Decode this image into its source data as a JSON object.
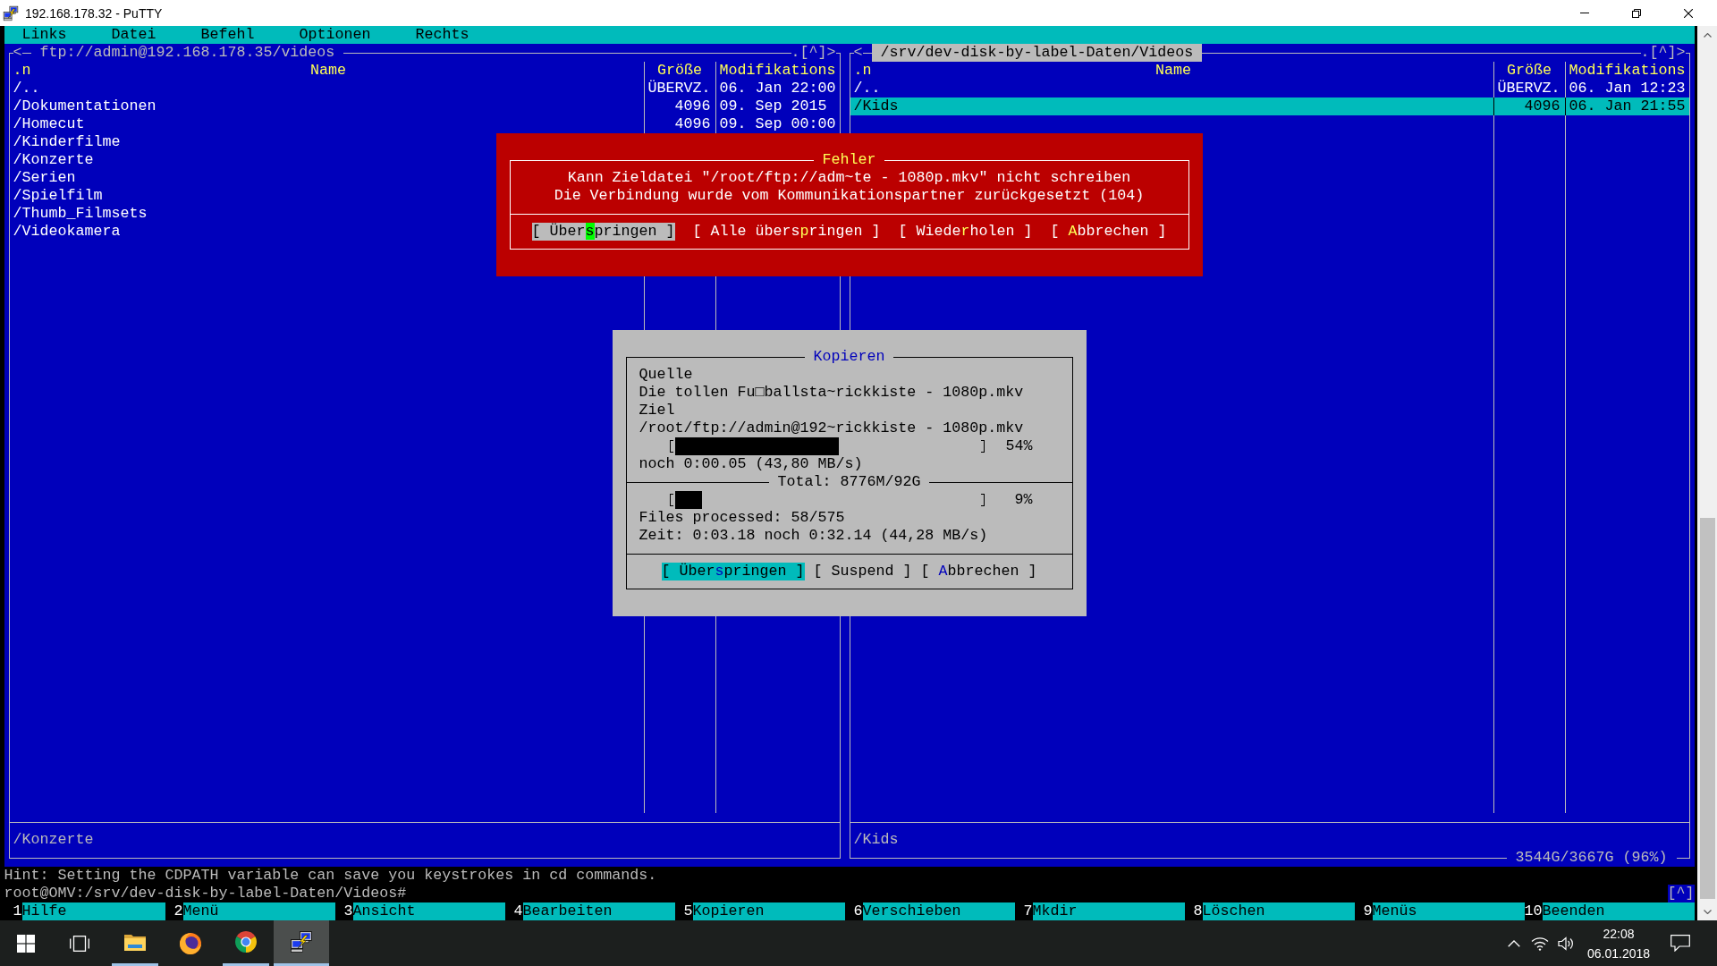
{
  "window": {
    "title": "192.168.178.32 - PuTTY"
  },
  "menu_bar": [
    "Links",
    "Datei",
    "Befehl",
    "Optionen",
    "Rechts"
  ],
  "panels": [
    {
      "active": false,
      "back": "<",
      "path": "ftp://admin@192.168.178.35/videos",
      "hidden_toggle": ".",
      "history": "[^]",
      "forward": ">",
      "sort_indicator": ".n",
      "columns": [
        "Name",
        "Größe",
        "Modifikations"
      ],
      "entries": [
        {
          "name": "/..",
          "size": "ÜBERVZ.",
          "modified": "06. Jan 22:00",
          "selected": false
        },
        {
          "name": "/Dokumentationen",
          "size": "4096",
          "modified": "09. Sep 2015",
          "selected": false
        },
        {
          "name": "/Homecut",
          "size": "4096",
          "modified": "09. Sep 00:00",
          "selected": false
        },
        {
          "name": "/Kinderfilme",
          "selected": false
        },
        {
          "name": "/Konzerte",
          "selected": false
        },
        {
          "name": "/Serien",
          "selected": false
        },
        {
          "name": "/Spielfilm",
          "selected": false
        },
        {
          "name": "/Thumb_Filmsets",
          "selected": false
        },
        {
          "name": "/Videokamera",
          "selected": false
        }
      ],
      "mini_status": "/Konzerte"
    },
    {
      "active": true,
      "back": "<",
      "path": "/srv/dev-disk-by-label-Daten/Videos",
      "hidden_toggle": ".",
      "history": "[^]",
      "forward": ">",
      "sort_indicator": ".n",
      "columns": [
        "Name",
        "Größe",
        "Modifikations"
      ],
      "entries": [
        {
          "name": "/..",
          "size": "ÜBERVZ.",
          "modified": "06. Jan 12:23",
          "selected": false
        },
        {
          "name": "/Kids",
          "size": "4096",
          "modified": "06. Jan 21:55",
          "selected": true
        }
      ],
      "mini_status": "/Kids",
      "free_space": "3544G/3667G (96%)"
    }
  ],
  "error_dialog": {
    "title": "Fehler",
    "messages": [
      "Kann Zieldatei \"/root/ftp://adm~te - 1080p.mkv\" nicht schreiben",
      "Die Verbindung wurde vom Kommunikationspartner zurückgesetzt (104)"
    ],
    "buttons": [
      {
        "label_start": "[ Über",
        "hotkey": "s",
        "label_end": "pringen ]",
        "selected": true,
        "cursor": true
      },
      {
        "label_start": "[ Alle übers",
        "hotkey": "p",
        "label_end": "ringen ]",
        "selected": false,
        "cursor": false
      },
      {
        "label_start": "[ Wiede",
        "hotkey": "r",
        "label_end": "holen ]",
        "selected": false,
        "cursor": false
      },
      {
        "label_start": "[ ",
        "hotkey": "A",
        "label_end": "bbrechen ]",
        "selected": false,
        "cursor": false
      }
    ]
  },
  "copy_dialog": {
    "title": "Kopieren",
    "source_label": "Quelle",
    "source": "Die tollen Fu□ballsta~rickkiste - 1080p.mkv",
    "target_label": "Ziel",
    "target": "/root/ftp://admin@192~rickkiste - 1080p.mkv",
    "file_progress": {
      "level": 0.54,
      "reading": "54%"
    },
    "file_eta": "noch 0:00.05 (43,80 MB/s)",
    "total": "Total: 8776M/92G",
    "total_progress": {
      "level": 0.09,
      "reading": "9%"
    },
    "files_processed": "Files processed: 58/575",
    "time": "Zeit: 0:03.18 noch 0:32.14 (44,28 MB/s)",
    "buttons": [
      {
        "label_start": "[ Über",
        "hotkey": "s",
        "label_end": "pringen ]",
        "selected": true
      },
      {
        "label_start": "[ Suspend ]",
        "selected": false
      },
      {
        "label_start": "[ ",
        "hotkey": "A",
        "label_end": "bbrechen ]",
        "selected": false
      }
    ]
  },
  "hint": "Hint: Setting the CDPATH variable can save you keystrokes in cd commands.",
  "prompt": "root@OMV:/srv/dev-disk-by-label-Daten/Videos#",
  "history_button": "[^]",
  "function_keys": [
    {
      "number": "1",
      "label": "Hilfe"
    },
    {
      "number": "2",
      "label": "Menü"
    },
    {
      "number": "3",
      "label": "Ansicht"
    },
    {
      "number": "4",
      "label": "Bearbeiten"
    },
    {
      "number": "5",
      "label": "Kopieren"
    },
    {
      "number": "6",
      "label": "Verschieben"
    },
    {
      "number": "7",
      "label": "Mkdir"
    },
    {
      "number": "8",
      "label": "Löschen"
    },
    {
      "number": "9",
      "label": "Menüs"
    },
    {
      "number": "10",
      "label": "Beenden"
    }
  ],
  "taskbar": {
    "apps": [
      {
        "running": true,
        "selected": false
      },
      {
        "running": false,
        "selected": false
      },
      {
        "running": true,
        "selected": false
      },
      {
        "running": true,
        "selected": true
      }
    ],
    "clock": {
      "time": "22:08",
      "date": "06.01.2018"
    }
  }
}
